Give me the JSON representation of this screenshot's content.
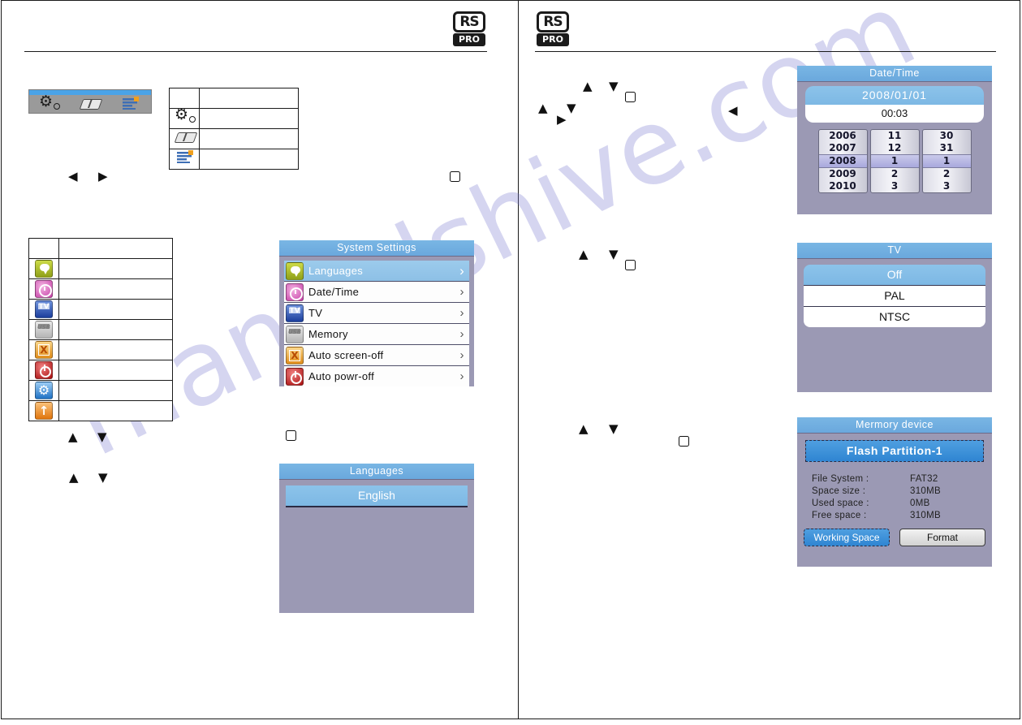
{
  "brand": {
    "top": "RS",
    "bottom": "PRO"
  },
  "nav_widget": {
    "icons": [
      {
        "name": "settings-gear-icon"
      },
      {
        "name": "book-icon"
      },
      {
        "name": "list-document-icon"
      }
    ]
  },
  "mode_table": {
    "rows": [
      {
        "icon": "header",
        "label": ""
      },
      {
        "icon": "settings-gear-icon",
        "label": ""
      },
      {
        "icon": "book-icon",
        "label": ""
      },
      {
        "icon": "list-document-icon",
        "label": ""
      }
    ]
  },
  "icon_legend_table": {
    "rows": [
      {
        "icon": "header",
        "label": ""
      },
      {
        "icon": "languages-icon",
        "label": ""
      },
      {
        "icon": "date-time-icon",
        "label": ""
      },
      {
        "icon": "tv-icon",
        "label": ""
      },
      {
        "icon": "memory-usb-icon",
        "label": ""
      },
      {
        "icon": "auto-screen-off-icon",
        "label": ""
      },
      {
        "icon": "auto-power-off-icon",
        "label": ""
      },
      {
        "icon": "system-gear-icon",
        "label": ""
      },
      {
        "icon": "upload-icon",
        "label": ""
      }
    ]
  },
  "system_settings": {
    "title": "System Settings",
    "items": [
      {
        "label": "Languages",
        "icon": "languages-icon",
        "chevron": "›",
        "selected": true
      },
      {
        "label": "Date/Time",
        "icon": "date-time-icon",
        "chevron": "›",
        "selected": false
      },
      {
        "label": "TV",
        "icon": "tv-icon",
        "chevron": "›",
        "selected": false
      },
      {
        "label": "Memory",
        "icon": "memory-usb-icon",
        "chevron": "›",
        "selected": false
      },
      {
        "label": "Auto  screen-off",
        "icon": "auto-screen-off-icon",
        "chevron": "›",
        "selected": false
      },
      {
        "label": "Auto  powr-off",
        "icon": "auto-power-off-icon",
        "chevron": "›",
        "selected": false
      }
    ]
  },
  "languages_panel": {
    "title": "Languages",
    "options": [
      {
        "label": "English",
        "selected": true
      }
    ]
  },
  "datetime_panel": {
    "title": "Date/Time",
    "date_value": "2008/01/01",
    "time_value": "00:03",
    "year_column": {
      "above": [
        "2006",
        "2007"
      ],
      "current": "2008",
      "below": [
        "2009",
        "2010"
      ]
    },
    "month_column": {
      "above": [
        "11",
        "12"
      ],
      "current": "1",
      "below": [
        "2",
        "3"
      ]
    },
    "day_column": {
      "above": [
        "30",
        "31"
      ],
      "current": "1",
      "below": [
        "2",
        "3"
      ]
    }
  },
  "tv_panel": {
    "title": "TV",
    "options": [
      {
        "label": "Off",
        "selected": true
      },
      {
        "label": "PAL",
        "selected": false
      },
      {
        "label": "NTSC",
        "selected": false
      }
    ]
  },
  "memory_panel": {
    "title": "Mermory device",
    "partition": "Flash  Partition-1",
    "info": [
      {
        "key": "File System :",
        "value": "FAT32"
      },
      {
        "key": "Space size   :",
        "value": "310MB"
      },
      {
        "key": "Used space :",
        "value": "0MB"
      },
      {
        "key": "Free space  :",
        "value": "310MB"
      }
    ],
    "buttons": [
      {
        "label": "Working Space",
        "primary": true
      },
      {
        "label": "Format",
        "primary": false
      }
    ]
  },
  "key_glyphs": {
    "up": "▲",
    "down": "▼",
    "left": "◀",
    "right": "▶"
  },
  "watermark": {
    "text": "manualshive.com"
  },
  "colors": {
    "lcd_background": "#9b99b4",
    "lcd_title_bar": "#79b6e4",
    "selection_blue": "#8dc0e6",
    "primary_button": "#2f85d2"
  }
}
